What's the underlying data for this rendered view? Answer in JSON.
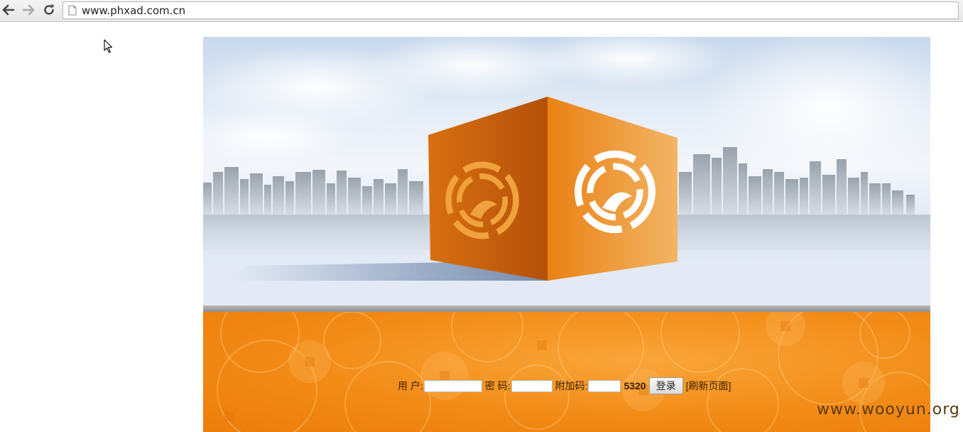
{
  "browser": {
    "url": "www.phxad.com.cn",
    "icons": {
      "back": "arrow-left-icon",
      "forward": "arrow-right-icon",
      "reload": "reload-icon",
      "page": "page-icon"
    }
  },
  "banner": {
    "logo": "phoenix-logo",
    "colors": {
      "cube_orange": "#e8860f",
      "cube_dark": "#b85206",
      "sky": "#dfe7f2"
    }
  },
  "login": {
    "user_label": "用 户:",
    "password_label": "密 码:",
    "extra_code_label": "附加码:",
    "code_value": "5320",
    "submit_label": "登录",
    "refresh_label": "[刷新页面]",
    "user_value": "",
    "password_value": "",
    "extra_code_value": ""
  },
  "watermark": "www.wooyun.org",
  "colors": {
    "panel_orange": "#f28b16",
    "divider": "#a8a8a8"
  }
}
